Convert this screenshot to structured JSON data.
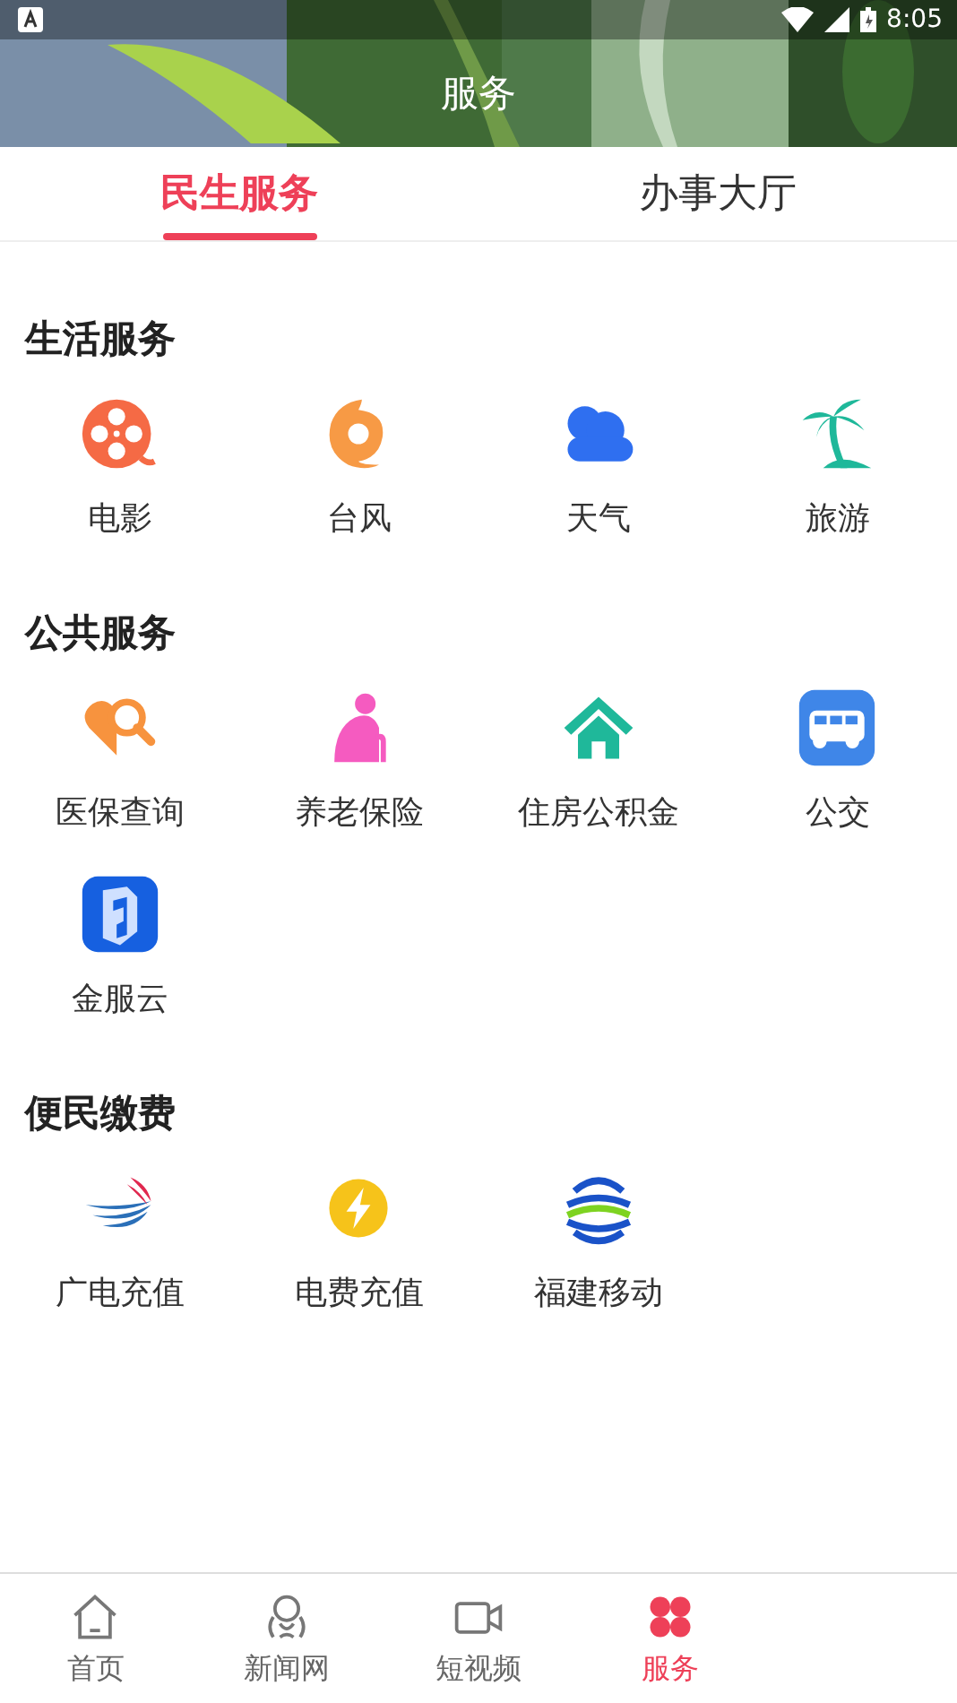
{
  "status_bar": {
    "time": "8:05"
  },
  "header": {
    "title": "服务"
  },
  "tabs": [
    {
      "label": "民生服务",
      "selected": true
    },
    {
      "label": "办事大厅",
      "selected": false
    }
  ],
  "sections": [
    {
      "title": "生活服务",
      "items": [
        {
          "label": "电影",
          "kind": "film"
        },
        {
          "label": "台风",
          "kind": "typhoon"
        },
        {
          "label": "天气",
          "kind": "weather"
        },
        {
          "label": "旅游",
          "kind": "palm"
        }
      ]
    },
    {
      "title": "公共服务",
      "items": [
        {
          "label": "医保查询",
          "kind": "medical"
        },
        {
          "label": "养老保险",
          "kind": "elder"
        },
        {
          "label": "住房公积金",
          "kind": "house"
        },
        {
          "label": "公交",
          "kind": "bus"
        },
        {
          "label": "金服云",
          "kind": "cloudapp"
        }
      ]
    },
    {
      "title": "便民缴费",
      "items": [
        {
          "label": "广电充值",
          "kind": "wing"
        },
        {
          "label": "电费充值",
          "kind": "bolt"
        },
        {
          "label": "福建移动",
          "kind": "mobile"
        }
      ]
    }
  ],
  "bottom_nav": [
    {
      "label": "首页",
      "kind": "home",
      "selected": false
    },
    {
      "label": "新闻网",
      "kind": "news",
      "selected": false
    },
    {
      "label": "短视频",
      "kind": "video",
      "selected": false
    },
    {
      "label": "服务",
      "kind": "service",
      "selected": true
    }
  ]
}
